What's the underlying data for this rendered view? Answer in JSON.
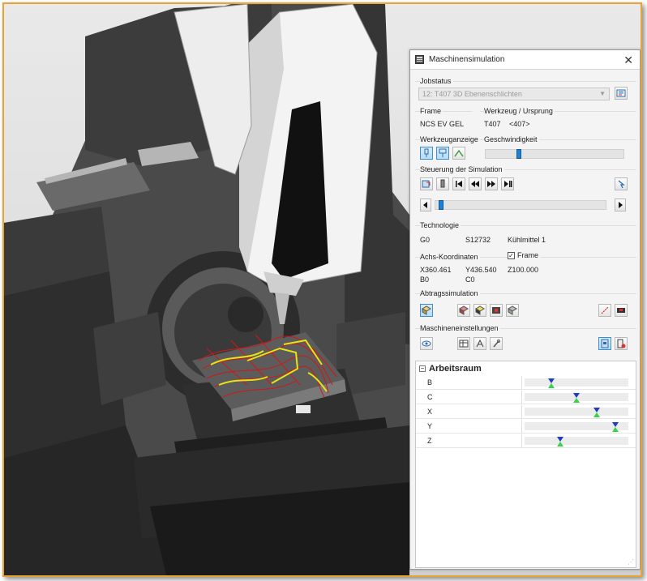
{
  "window": {
    "title": "Maschinensimulation"
  },
  "jobstatus": {
    "label": "Jobstatus",
    "selected": "12: T407 3D Ebenenschlichten"
  },
  "frame": {
    "label": "Frame",
    "value": "NCS EV GEL"
  },
  "tool_origin": {
    "label": "Werkzeug / Ursprung",
    "tool": "T407",
    "origin": "<407>"
  },
  "tool_display": {
    "label": "Werkzeuganzeige"
  },
  "speed": {
    "label": "Geschwindigkeit",
    "level": 0.23
  },
  "simulation_control": {
    "label": "Steuerung der Simulation",
    "progress": 0.02
  },
  "technology": {
    "label": "Technologie",
    "mode": "G0",
    "spindle": "S12732",
    "coolant": "Kühlmittel  1"
  },
  "axis_coords": {
    "label": "Achs-Koordinaten",
    "frame_checkbox_label": "Frame",
    "frame_checked": true,
    "x": "X360.461",
    "y": "Y436.540",
    "z": "Z100.000",
    "b": "B0",
    "c": "C0"
  },
  "removal_sim": {
    "label": "Abtragssimulation"
  },
  "machine_settings": {
    "label": "Maschineneinstellungen"
  },
  "workspace": {
    "title": "Arbeitsraum",
    "axes": [
      {
        "name": "B",
        "level": 0.24
      },
      {
        "name": "C",
        "level": 0.5
      },
      {
        "name": "X",
        "level": 0.71
      },
      {
        "name": "Y",
        "level": 0.9
      },
      {
        "name": "Z",
        "level": 0.33
      }
    ]
  },
  "colors": {
    "frame_border": "#e8a236",
    "accent": "#1e7fd8",
    "marker_top": "#1e3fbf",
    "marker_bottom": "#3ad14c"
  }
}
